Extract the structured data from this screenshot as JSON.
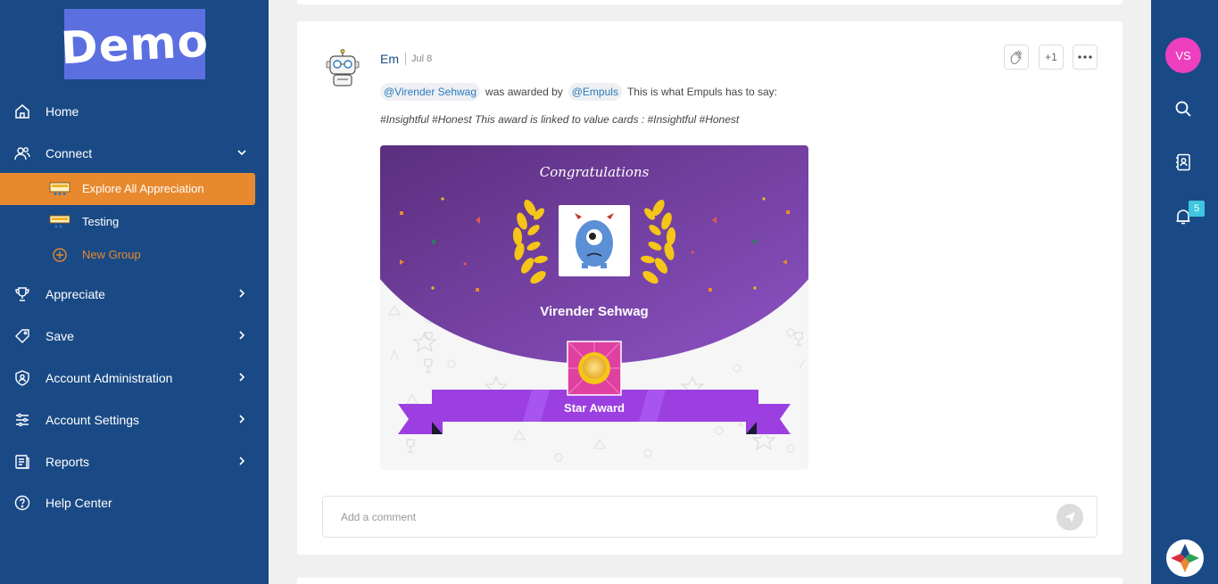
{
  "brand": {
    "logo_text": "Demo"
  },
  "sidebar": {
    "items": [
      {
        "label": "Home",
        "icon": "home-icon"
      },
      {
        "label": "Connect",
        "icon": "users-icon"
      },
      {
        "label": "Appreciate",
        "icon": "trophy-icon"
      },
      {
        "label": "Save",
        "icon": "tag-icon"
      },
      {
        "label": "Account Administration",
        "icon": "shield-user-icon"
      },
      {
        "label": "Account Settings",
        "icon": "sliders-icon"
      },
      {
        "label": "Reports",
        "icon": "report-icon"
      },
      {
        "label": "Help Center",
        "icon": "help-icon"
      }
    ],
    "connect_sub": [
      {
        "label": "Explore All Appreciation",
        "icon": "group-banner-icon",
        "active": true
      },
      {
        "label": "Testing",
        "icon": "group-banner-icon"
      },
      {
        "label": "New Group",
        "icon": "plus-circle-icon"
      }
    ]
  },
  "rightbar": {
    "avatar_initials": "VS",
    "notification_count": "5",
    "icons": [
      "search-icon",
      "contacts-icon",
      "bell-icon",
      "app-logo-icon"
    ]
  },
  "post": {
    "author": "Em",
    "date": "Jul 8",
    "actions": {
      "plus_one": "+1"
    },
    "recipient_mention": "@Virender Sehwag",
    "awarded_by_text": "was awarded by",
    "giver_mention": "@Empuls",
    "message_text": "This is what Empuls has to say:",
    "hashtag_line": "#Insightful #Honest This award is linked to value cards : #Insightful #Honest",
    "award_card": {
      "congrats_text": "Congratulations",
      "recipient_name": "Virender Sehwag",
      "award_name": "Star Award"
    },
    "comment": {
      "placeholder": "Add a comment"
    }
  },
  "colors": {
    "sidebar_bg": "#1a4a86",
    "active_item": "#e8892e",
    "award_purple": "#7a3fa8",
    "ribbon": "#9b3fe0",
    "avatar": "#ee3fbe"
  }
}
